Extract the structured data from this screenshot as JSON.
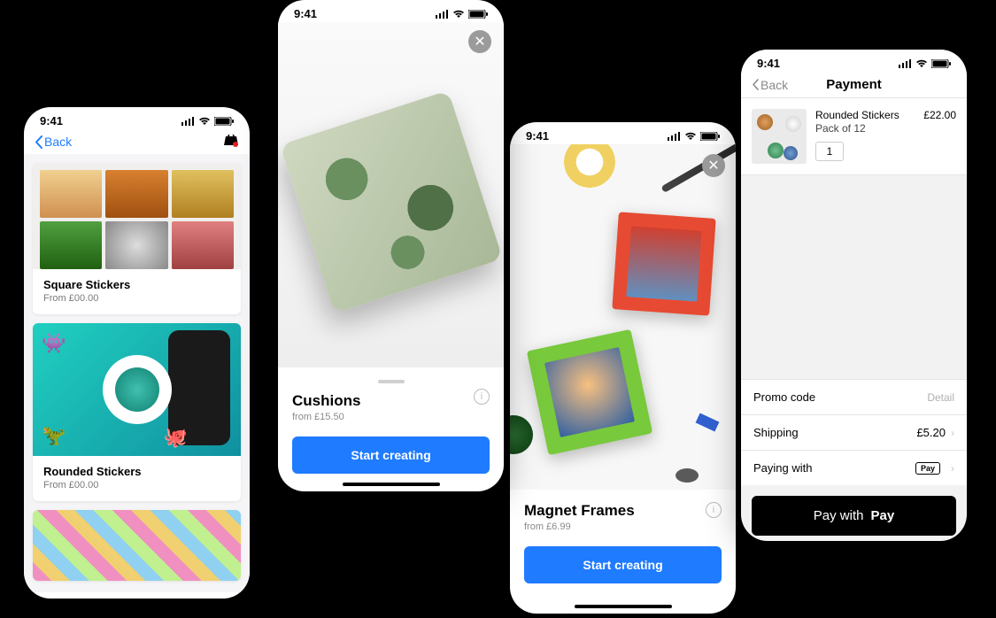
{
  "status_time": "9:41",
  "back_label": "Back",
  "phone1": {
    "cards": [
      {
        "title": "Square Stickers",
        "sub": "From £00.00"
      },
      {
        "title": "Rounded Stickers",
        "sub": "From £00.00"
      }
    ]
  },
  "phone2": {
    "title": "Cushions",
    "sub": "from £15.50",
    "cta": "Start creating"
  },
  "phone3": {
    "title": "Magnet Frames",
    "sub": "from £6.99",
    "cta": "Start creating"
  },
  "phone4": {
    "title": "Payment",
    "item_name": "Rounded Stickers",
    "item_pack": "Pack of 12",
    "item_price": "£22.00",
    "qty": "1",
    "promo_label": "Promo code",
    "promo_detail": "Detail",
    "shipping_label": "Shipping",
    "shipping_price": "£5.20",
    "paying_label": "Paying with",
    "paying_method": "Pay",
    "pay_btn_prefix": "Pay with",
    "pay_btn_brand": "Pay"
  }
}
